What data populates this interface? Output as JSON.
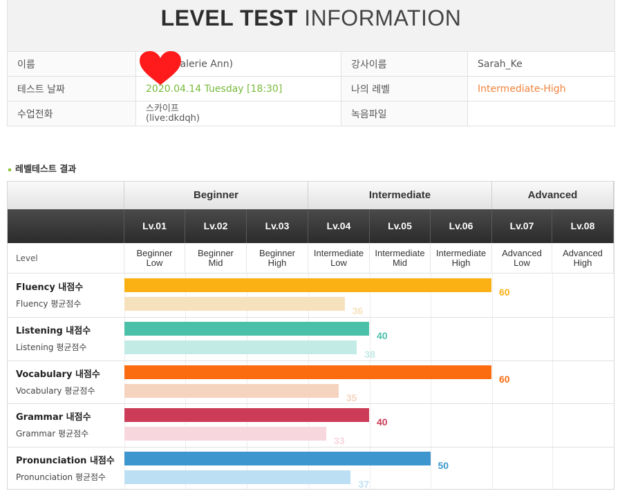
{
  "header": {
    "title_bold": "LEVEL TEST",
    "title_light": "INFORMATION"
  },
  "info": {
    "name_label": "이름",
    "name_value": "Valerie Ann)",
    "teacher_label": "강사이름",
    "teacher_value": "Sarah_Ke",
    "date_label": "테스트 날짜",
    "date_value": "2020.04.14  Tuesday [18:30]",
    "level_label": "나의 레벨",
    "level_value": "Intermediate-High",
    "phone_label": "수업전화",
    "phone_value_line1": "스카이프",
    "phone_value_line2": "(live:dkdqh)",
    "recording_label": "녹음파일",
    "recording_value": ""
  },
  "section_title": "레벨테스트 결과",
  "colors": {
    "fluency": "#fbb013",
    "fluency_avg": "#f6e1bd",
    "listening": "#4bc0a8",
    "listening_avg": "#c1ebe4",
    "vocabulary": "#fb6c10",
    "vocabulary_avg": "#f6d3bf",
    "grammar": "#cc3b57",
    "grammar_avg": "#f8d6de",
    "pronunciation": "#3d96cd",
    "pronunciation_avg": "#bddff4"
  },
  "grid": {
    "level_row_label": "Level",
    "bands": [
      {
        "label": "Beginner",
        "span": 3
      },
      {
        "label": "Intermediate",
        "span": 3
      },
      {
        "label": "Advanced",
        "span": 2
      }
    ],
    "levels": [
      {
        "code": "Lv.01",
        "name1": "Beginner",
        "name2": "Low"
      },
      {
        "code": "Lv.02",
        "name1": "Beginner",
        "name2": "Mid"
      },
      {
        "code": "Lv.03",
        "name1": "Beginner",
        "name2": "High"
      },
      {
        "code": "Lv.04",
        "name1": "Intermediate",
        "name2": "Low"
      },
      {
        "code": "Lv.05",
        "name1": "Intermediate",
        "name2": "Mid"
      },
      {
        "code": "Lv.06",
        "name1": "Intermediate",
        "name2": "High"
      },
      {
        "code": "Lv.07",
        "name1": "Advanced",
        "name2": "Low"
      },
      {
        "code": "Lv.08",
        "name1": "Advanced",
        "name2": "High"
      }
    ]
  },
  "chart_data": {
    "type": "bar",
    "orientation": "horizontal",
    "max": 80,
    "categories": [
      "Fluency",
      "Listening",
      "Vocabulary",
      "Grammar",
      "Pronunciation"
    ],
    "series": [
      {
        "name": "내점수",
        "values": [
          60,
          40,
          60,
          40,
          50
        ]
      },
      {
        "name": "평균점수",
        "values": [
          36,
          38,
          35,
          33,
          37
        ]
      }
    ],
    "rows": [
      {
        "key": "fluency",
        "mine_label": "Fluency 내점수",
        "avg_label": "Fluency 평균점수",
        "mine": 60,
        "avg": 36,
        "mine_text": "60",
        "avg_text": "36"
      },
      {
        "key": "listening",
        "mine_label": "Listening 내점수",
        "avg_label": "Listening 평균점수",
        "mine": 40,
        "avg": 38,
        "mine_text": "40",
        "avg_text": "38"
      },
      {
        "key": "vocabulary",
        "mine_label": "Vocabulary 내점수",
        "avg_label": "Vocabulary 평균점수",
        "mine": 60,
        "avg": 35,
        "mine_text": "60",
        "avg_text": "35"
      },
      {
        "key": "grammar",
        "mine_label": "Grammar 내점수",
        "avg_label": "Grammar 평균점수",
        "mine": 40,
        "avg": 33,
        "mine_text": "40",
        "avg_text": "33"
      },
      {
        "key": "pronunciation",
        "mine_label": "Pronunciation 내점수",
        "avg_label": "Pronunciation 평균점수",
        "mine": 50,
        "avg": 37,
        "mine_text": "50",
        "avg_text": "37"
      }
    ]
  }
}
